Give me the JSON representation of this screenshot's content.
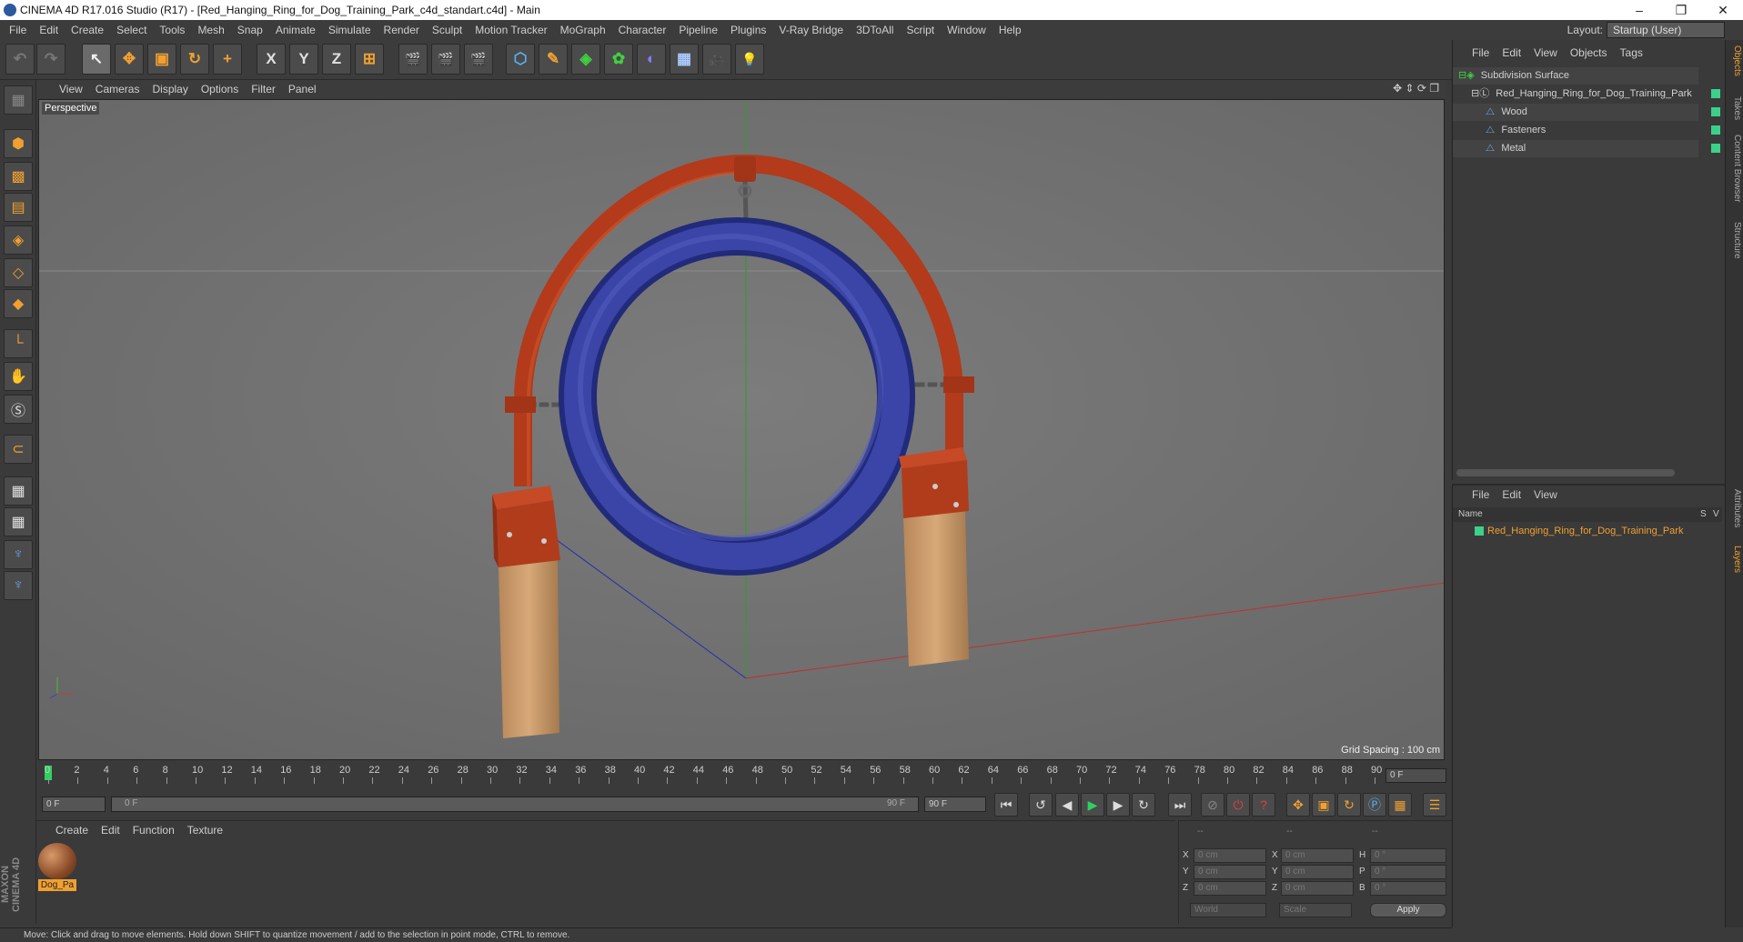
{
  "window": {
    "title": "CINEMA 4D R17.016 Studio (R17) - [Red_Hanging_Ring_for_Dog_Training_Park_c4d_standart.c4d] - Main",
    "min": "–",
    "max": "❐",
    "close": "✕"
  },
  "menu": [
    "File",
    "Edit",
    "Create",
    "Select",
    "Tools",
    "Mesh",
    "Snap",
    "Animate",
    "Simulate",
    "Render",
    "Sculpt",
    "Motion Tracker",
    "MoGraph",
    "Character",
    "Pipeline",
    "Plugins",
    "V-Ray Bridge",
    "3DToAll",
    "Script",
    "Window",
    "Help"
  ],
  "layout": {
    "label": "Layout:",
    "value": "Startup (User)"
  },
  "toolbar": {
    "undo": "↶",
    "redo": "↷",
    "select": "↖",
    "move": "✥",
    "scale": "▣",
    "rotate": "↻",
    "add": "+",
    "x": "X",
    "y": "Y",
    "z": "Z",
    "coord": "⊞",
    "render1": "🎬",
    "render2": "🎬",
    "render3": "🎬",
    "cube": "⬡",
    "pen": "✎",
    "subdiv": "◈",
    "clone": "✿",
    "deform": "◐",
    "floor": "▦",
    "camera": "🎥",
    "light": "💡"
  },
  "viewport_menu": [
    "View",
    "Cameras",
    "Display",
    "Options",
    "Filter",
    "Panel"
  ],
  "viewport": {
    "label": "Perspective",
    "grid_spacing": "Grid Spacing : 100 cm"
  },
  "timeline": {
    "ticks": [
      "0",
      "2",
      "4",
      "6",
      "8",
      "10",
      "12",
      "14",
      "16",
      "18",
      "20",
      "22",
      "24",
      "26",
      "28",
      "30",
      "32",
      "34",
      "36",
      "38",
      "40",
      "42",
      "44",
      "46",
      "48",
      "50",
      "52",
      "54",
      "56",
      "58",
      "60",
      "62",
      "64",
      "66",
      "68",
      "70",
      "72",
      "74",
      "76",
      "78",
      "80",
      "82",
      "84",
      "86",
      "88",
      "90"
    ],
    "current_frame": "0 F"
  },
  "playback": {
    "start": "0 F",
    "slider_start": "0 F",
    "slider_end": "90 F",
    "end": "90 F"
  },
  "material_menu": [
    "Create",
    "Edit",
    "Function",
    "Texture"
  ],
  "material": {
    "name": "Dog_Pa"
  },
  "coords": {
    "header1": "--",
    "header2": "--",
    "header3": "--",
    "x": "0 cm",
    "y": "0 cm",
    "z": "0 cm",
    "x2": "0 cm",
    "y2": "0 cm",
    "z2": "0 cm",
    "h": "0 °",
    "p": "0 °",
    "b": "0 °",
    "mode": "World",
    "scale": "Scale",
    "apply": "Apply"
  },
  "status": "Move: Click and drag to move elements. Hold down SHIFT to quantize movement / add to the selection in point mode, CTRL to remove.",
  "objects_menu": [
    "File",
    "Edit",
    "View",
    "Objects",
    "Tags"
  ],
  "objects": [
    {
      "name": "Subdivision Surface"
    },
    {
      "name": "Red_Hanging_Ring_for_Dog_Training_Park"
    },
    {
      "name": "Wood"
    },
    {
      "name": "Fasteners"
    },
    {
      "name": "Metal"
    }
  ],
  "layers_menu": [
    "File",
    "Edit",
    "View"
  ],
  "layers": {
    "col_name": "Name",
    "col_s": "S",
    "col_v": "V",
    "row": "Red_Hanging_Ring_for_Dog_Training_Park"
  },
  "right_tabs": [
    "Objects",
    "Takes",
    "Content Browser",
    "Structure",
    "Attributes",
    "Layers"
  ],
  "brand": "MAXON CINEMA 4D"
}
